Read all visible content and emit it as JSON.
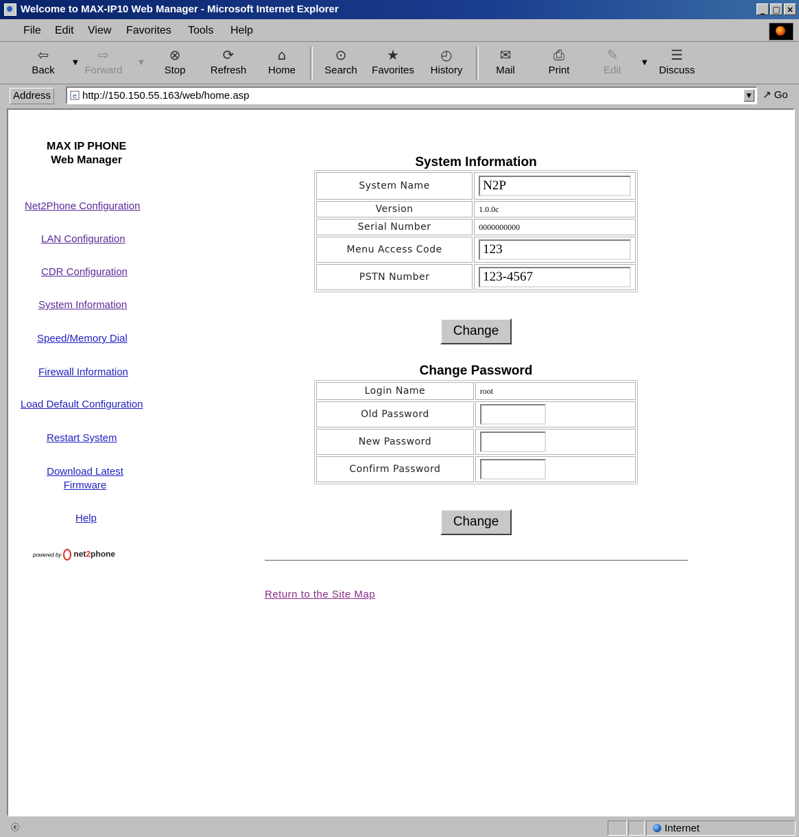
{
  "window": {
    "title": "Welcome to MAX-IP10 Web Manager - Microsoft Internet Explorer",
    "controls": [
      "_",
      "□",
      "×"
    ]
  },
  "menu": [
    "File",
    "Edit",
    "View",
    "Favorites",
    "Tools",
    "Help"
  ],
  "toolbar": [
    {
      "label": "Back",
      "icon": "⇦",
      "icon_name": "back-arrow-icon",
      "enabled": true
    },
    {
      "label": "Forward",
      "icon": "⇨",
      "icon_name": "forward-arrow-icon",
      "enabled": false
    },
    {
      "label": "Stop",
      "icon": "⊗",
      "icon_name": "stop-icon",
      "enabled": true
    },
    {
      "label": "Refresh",
      "icon": "⟳",
      "icon_name": "refresh-icon",
      "enabled": true
    },
    {
      "label": "Home",
      "icon": "⌂",
      "icon_name": "home-icon",
      "enabled": true
    },
    {
      "label": "Search",
      "icon": "⊙",
      "icon_name": "search-icon",
      "enabled": true
    },
    {
      "label": "Favorites",
      "icon": "★",
      "icon_name": "favorites-icon",
      "enabled": true
    },
    {
      "label": "History",
      "icon": "◴",
      "icon_name": "history-icon",
      "enabled": true
    },
    {
      "label": "Mail",
      "icon": "✉",
      "icon_name": "mail-icon",
      "enabled": true
    },
    {
      "label": "Print",
      "icon": "⎙",
      "icon_name": "print-icon",
      "enabled": true
    },
    {
      "label": "Edit",
      "icon": "✎",
      "icon_name": "edit-icon",
      "enabled": false
    },
    {
      "label": "Discuss",
      "icon": "☰",
      "icon_name": "discuss-icon",
      "enabled": true
    }
  ],
  "address": {
    "label": "Address",
    "url": "http://150.150.55.163/web/home.asp",
    "go": "Go"
  },
  "sidebar": {
    "brand_line1": "MAX IP PHONE",
    "brand_line2": "Web Manager",
    "links": [
      "Net2Phone Configuration",
      "LAN Configuration",
      "CDR Configuration",
      "System Information",
      "Speed/Memory Dial",
      "Firewall Information",
      "Load Default Configuration",
      "Restart System",
      "Download Latest Firmware",
      "Help"
    ],
    "powered_prefix": "powered by",
    "powered_brand_a": "net",
    "powered_brand_b": "2",
    "powered_brand_c": "phone"
  },
  "system_info": {
    "title": "System Information",
    "rows": [
      {
        "label": "System Name",
        "value": "N2P",
        "editable": true
      },
      {
        "label": "Version",
        "value": "1.0.0c",
        "editable": false
      },
      {
        "label": "Serial Number",
        "value": "0000000000",
        "editable": false
      },
      {
        "label": "Menu Access Code",
        "value": "123",
        "editable": true
      },
      {
        "label": "PSTN Number",
        "value": "123-4567",
        "editable": true
      }
    ],
    "button": "Change"
  },
  "password": {
    "title": "Change Password",
    "login_label": "Login Name",
    "login_value": "root",
    "old_label": "Old Password",
    "new_label": "New Password",
    "confirm_label": "Confirm Password",
    "button": "Change"
  },
  "return_link": "Return to the Site Map",
  "status": {
    "zone": "Internet"
  }
}
